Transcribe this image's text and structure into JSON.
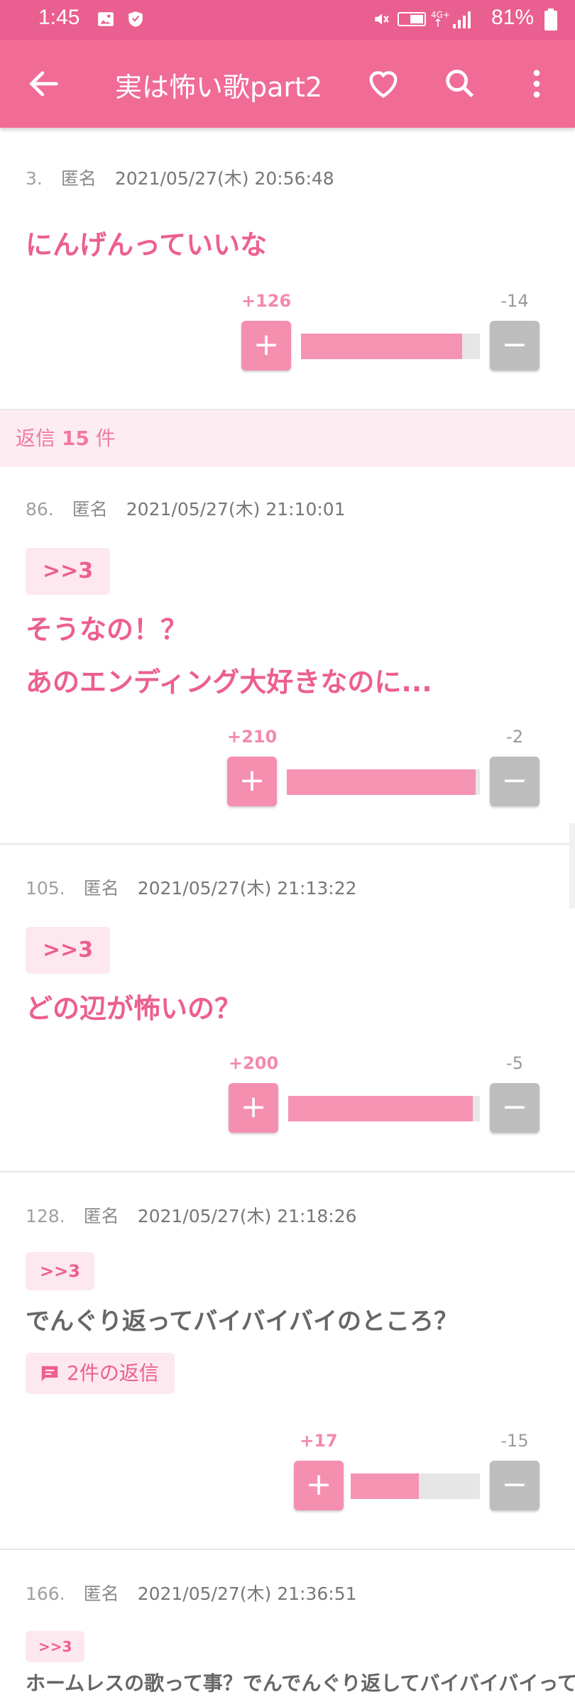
{
  "status": {
    "time": "1:45",
    "battery": "81%"
  },
  "appbar": {
    "title": "実は怖い歌part2"
  },
  "icons": {
    "back": "arrow-back-icon",
    "favorite": "heart-icon",
    "search": "search-icon",
    "more": "more-vert-icon",
    "gallery": "image-icon",
    "shield": "shield-icon",
    "comment": "comment-icon"
  },
  "colors": {
    "accent": "#f06c96",
    "plus": "#f58fb0",
    "minus": "#bdbdbd",
    "anchor_bg": "#fde8ef"
  },
  "main_post": {
    "num": "3.",
    "name": "匿名",
    "date": "2021/05/27(木) 20:56:48",
    "text": "にんげんっていいな",
    "plus": "+126",
    "minus": "-14",
    "ratio": 0.9
  },
  "replies_banner": {
    "prefix": "返信",
    "count": "15",
    "suffix": "件"
  },
  "replies": [
    {
      "num": "86.",
      "name": "匿名",
      "date": "2021/05/27(木) 21:10:01",
      "anchor": ">>3",
      "line1": "そうなの！？",
      "line2": "あのエンディング大好きなのに...",
      "plus": "+210",
      "minus": "-2",
      "ratio": 0.99
    },
    {
      "num": "105.",
      "name": "匿名",
      "date": "2021/05/27(木) 21:13:22",
      "anchor": ">>3",
      "line1": "どの辺が怖いの？",
      "plus": "+200",
      "minus": "-5",
      "ratio": 0.98
    },
    {
      "num": "128.",
      "name": "匿名",
      "date": "2021/05/27(木) 21:18:26",
      "anchor": ">>3",
      "line1": "でんぐり返ってバイバイバイのところ？",
      "reply_link": "2件の返信",
      "plus": "+17",
      "minus": "-15",
      "ratio": 0.53
    },
    {
      "num": "166.",
      "name": "匿名",
      "date": "2021/05/27(木) 21:36:51",
      "anchor": ">>3",
      "line1": "ホームレスの歌って事？でんでんぐり返してバイバイバイって"
    }
  ],
  "plus_symbol": "+",
  "minus_symbol": "−"
}
